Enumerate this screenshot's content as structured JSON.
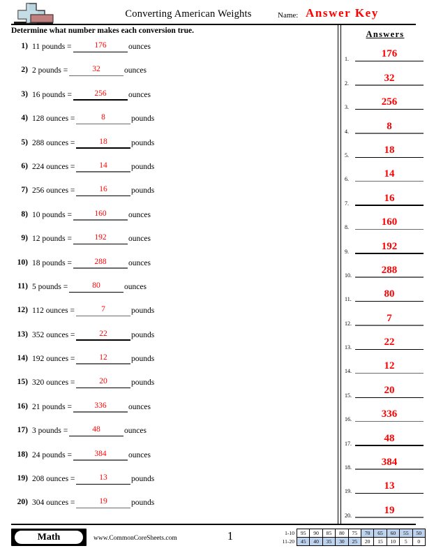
{
  "header": {
    "title": "Converting American Weights",
    "name_label": "Name:",
    "answer_key": "Answer Key",
    "instructions": "Determine what number makes each conversion true.",
    "logo_icon": "cross-and-bar-icon"
  },
  "answers_column": {
    "heading": "Answers"
  },
  "problems": [
    {
      "num": "1)",
      "question": "11 pounds =",
      "answer": "176",
      "unit": "ounces"
    },
    {
      "num": "2)",
      "question": "2 pounds =",
      "answer": "32",
      "unit": "ounces"
    },
    {
      "num": "3)",
      "question": "16 pounds =",
      "answer": "256",
      "unit": "ounces"
    },
    {
      "num": "4)",
      "question": "128 ounces =",
      "answer": "8",
      "unit": "pounds"
    },
    {
      "num": "5)",
      "question": "288 ounces =",
      "answer": "18",
      "unit": "pounds"
    },
    {
      "num": "6)",
      "question": "224 ounces =",
      "answer": "14",
      "unit": "pounds"
    },
    {
      "num": "7)",
      "question": "256 ounces =",
      "answer": "16",
      "unit": "pounds"
    },
    {
      "num": "8)",
      "question": "10 pounds =",
      "answer": "160",
      "unit": "ounces"
    },
    {
      "num": "9)",
      "question": "12 pounds =",
      "answer": "192",
      "unit": "ounces"
    },
    {
      "num": "10)",
      "question": "18 pounds =",
      "answer": "288",
      "unit": "ounces"
    },
    {
      "num": "11)",
      "question": "5 pounds =",
      "answer": "80",
      "unit": "ounces"
    },
    {
      "num": "12)",
      "question": "112 ounces =",
      "answer": "7",
      "unit": "pounds"
    },
    {
      "num": "13)",
      "question": "352 ounces =",
      "answer": "22",
      "unit": "pounds"
    },
    {
      "num": "14)",
      "question": "192 ounces =",
      "answer": "12",
      "unit": "pounds"
    },
    {
      "num": "15)",
      "question": "320 ounces =",
      "answer": "20",
      "unit": "pounds"
    },
    {
      "num": "16)",
      "question": "21 pounds =",
      "answer": "336",
      "unit": "ounces"
    },
    {
      "num": "17)",
      "question": "3 pounds =",
      "answer": "48",
      "unit": "ounces"
    },
    {
      "num": "18)",
      "question": "24 pounds =",
      "answer": "384",
      "unit": "ounces"
    },
    {
      "num": "19)",
      "question": "208 ounces =",
      "answer": "13",
      "unit": "pounds"
    },
    {
      "num": "20)",
      "question": "304 ounces =",
      "answer": "19",
      "unit": "pounds"
    }
  ],
  "answer_list": [
    {
      "n": "1.",
      "value": "176"
    },
    {
      "n": "2.",
      "value": "32"
    },
    {
      "n": "3.",
      "value": "256"
    },
    {
      "n": "4.",
      "value": "8"
    },
    {
      "n": "5.",
      "value": "18"
    },
    {
      "n": "6.",
      "value": "14"
    },
    {
      "n": "7.",
      "value": "16"
    },
    {
      "n": "8.",
      "value": "160"
    },
    {
      "n": "9.",
      "value": "192"
    },
    {
      "n": "10.",
      "value": "288"
    },
    {
      "n": "11.",
      "value": "80"
    },
    {
      "n": "12.",
      "value": "7"
    },
    {
      "n": "13.",
      "value": "22"
    },
    {
      "n": "14.",
      "value": "12"
    },
    {
      "n": "15.",
      "value": "20"
    },
    {
      "n": "16.",
      "value": "336"
    },
    {
      "n": "17.",
      "value": "48"
    },
    {
      "n": "18.",
      "value": "384"
    },
    {
      "n": "19.",
      "value": "13"
    },
    {
      "n": "20.",
      "value": "19"
    }
  ],
  "footer": {
    "subject_label": "Math",
    "website": "www.CommonCoreSheets.com",
    "page_number": "1",
    "score_table": {
      "row1_label": "1-10",
      "row2_label": "11-20",
      "row1": [
        {
          "v": "95",
          "highlighted": false
        },
        {
          "v": "90",
          "highlighted": false
        },
        {
          "v": "85",
          "highlighted": false
        },
        {
          "v": "80",
          "highlighted": false
        },
        {
          "v": "75",
          "highlighted": false
        },
        {
          "v": "70",
          "highlighted": true
        },
        {
          "v": "65",
          "highlighted": true
        },
        {
          "v": "60",
          "highlighted": true
        },
        {
          "v": "55",
          "highlighted": true
        },
        {
          "v": "50",
          "highlighted": true
        }
      ],
      "row2": [
        {
          "v": "45",
          "highlighted": true
        },
        {
          "v": "40",
          "highlighted": true
        },
        {
          "v": "35",
          "highlighted": true
        },
        {
          "v": "30",
          "highlighted": true
        },
        {
          "v": "25",
          "highlighted": true
        },
        {
          "v": "20",
          "highlighted": false
        },
        {
          "v": "15",
          "highlighted": false
        },
        {
          "v": "10",
          "highlighted": false
        },
        {
          "v": "5",
          "highlighted": false
        },
        {
          "v": "0",
          "highlighted": false
        }
      ]
    }
  },
  "colors": {
    "answer_red": "#ff0000",
    "highlight_blue": "#bdd3ee",
    "gray_line": "#6b6b6b"
  }
}
